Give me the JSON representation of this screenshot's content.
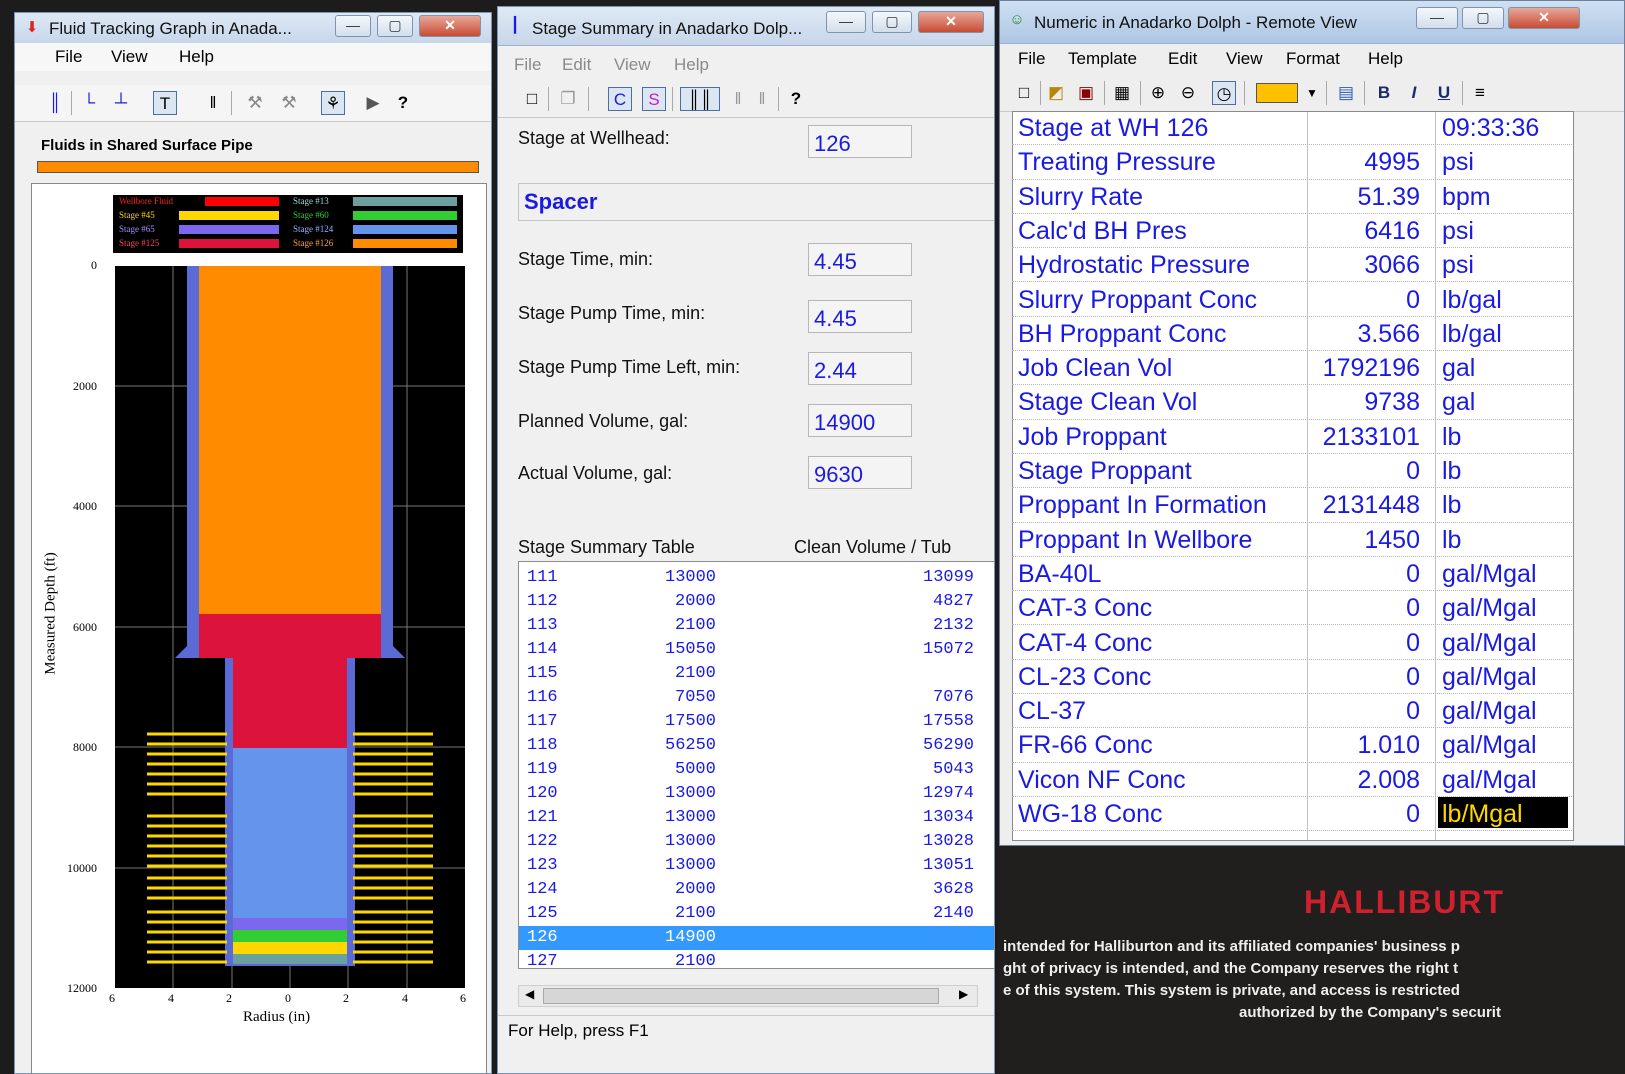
{
  "w1": {
    "title": "Fluid Tracking Graph in Anada...",
    "menu": [
      "File",
      "View",
      "Help"
    ],
    "pipe_label": "Fluids in Shared Surface Pipe",
    "legend": [
      {
        "name": "Wellbore Fluid",
        "color": "#ff0000"
      },
      {
        "name": "Stage #13",
        "color": "#6aa0a0"
      },
      {
        "name": "Stage #45",
        "color": "#ffd700"
      },
      {
        "name": "Stage #60",
        "color": "#32cd32"
      },
      {
        "name": "Stage #65",
        "color": "#7b68ee"
      },
      {
        "name": "Stage #124",
        "color": "#6495ed"
      },
      {
        "name": "Stage #125",
        "color": "#dc143c"
      },
      {
        "name": "Stage #126",
        "color": "#ff8c00"
      }
    ],
    "ylabel": "Measured Depth (ft)",
    "xlabel": "Radius (in)",
    "yticks": [
      "0",
      "2000",
      "4000",
      "6000",
      "8000",
      "10000",
      "12000"
    ],
    "xticks": [
      "6",
      "4",
      "2",
      "0",
      "2",
      "4",
      "6"
    ]
  },
  "w2": {
    "title": "Stage Summary in Anadarko Dolp...",
    "menu": [
      "File",
      "Edit",
      "View",
      "Help"
    ],
    "fields": [
      {
        "label": "Stage at Wellhead:",
        "value": "126"
      },
      {
        "label": "Stage Time, min:",
        "value": "4.45"
      },
      {
        "label": "Stage Pump Time, min:",
        "value": "4.45"
      },
      {
        "label": "Stage Pump Time Left, min:",
        "value": "2.44"
      },
      {
        "label": "Planned Volume, gal:",
        "value": "14900"
      },
      {
        "label": "Actual Volume, gal:",
        "value": "9630"
      }
    ],
    "fluid": "Spacer",
    "table_title": "Stage Summary Table",
    "table_col2": "Clean Volume  / Tub",
    "rows": [
      [
        "111",
        "13000",
        "13099"
      ],
      [
        "112",
        "2000",
        "4827"
      ],
      [
        "113",
        "2100",
        "2132"
      ],
      [
        "114",
        "15050",
        "15072"
      ],
      [
        "115",
        "2100",
        ""
      ],
      [
        "116",
        "7050",
        "7076"
      ],
      [
        "117",
        "17500",
        "17558"
      ],
      [
        "118",
        "56250",
        "56290"
      ],
      [
        "119",
        "5000",
        "5043"
      ],
      [
        "120",
        "13000",
        "12974"
      ],
      [
        "121",
        "13000",
        "13034"
      ],
      [
        "122",
        "13000",
        "13028"
      ],
      [
        "123",
        "13000",
        "13051"
      ],
      [
        "124",
        "2000",
        "3628"
      ],
      [
        "125",
        "2100",
        "2140"
      ],
      [
        "126",
        "14900",
        ""
      ],
      [
        "127",
        "2100",
        ""
      ]
    ],
    "status": "For Help, press F1"
  },
  "w3": {
    "title": "Numeric in Anadarko Dolph - Remote View",
    "menu": [
      "File",
      "Template",
      "Edit",
      "View",
      "Format",
      "Help"
    ],
    "rows": [
      {
        "label": "Stage at WH 126",
        "value": "",
        "unit": "09:33:36"
      },
      {
        "label": "Treating Pressure",
        "value": "4995",
        "unit": "psi"
      },
      {
        "label": "Slurry Rate",
        "value": "51.39",
        "unit": "bpm"
      },
      {
        "label": "Calc'd BH Pres",
        "value": "6416",
        "unit": "psi"
      },
      {
        "label": "Hydrostatic Pressure",
        "value": "3066",
        "unit": "psi"
      },
      {
        "label": "Slurry Proppant Conc",
        "value": "0",
        "unit": "lb/gal"
      },
      {
        "label": "BH Proppant Conc",
        "value": "3.566",
        "unit": "lb/gal"
      },
      {
        "label": "Job Clean Vol",
        "value": "1792196",
        "unit": "gal"
      },
      {
        "label": "Stage Clean Vol",
        "value": "9738",
        "unit": "gal"
      },
      {
        "label": "Job Proppant",
        "value": "2133101",
        "unit": "lb"
      },
      {
        "label": "Stage Proppant",
        "value": "0",
        "unit": "lb"
      },
      {
        "label": "Proppant In Formation",
        "value": "2131448",
        "unit": "lb"
      },
      {
        "label": "Proppant In Wellbore",
        "value": "1450",
        "unit": "lb"
      },
      {
        "label": "BA-40L",
        "value": "0",
        "unit": "gal/Mgal"
      },
      {
        "label": "CAT-3 Conc",
        "value": "0",
        "unit": "gal/Mgal"
      },
      {
        "label": "CAT-4 Conc",
        "value": "0",
        "unit": "gal/Mgal"
      },
      {
        "label": "CL-23 Conc",
        "value": "0",
        "unit": "gal/Mgal"
      },
      {
        "label": "CL-37",
        "value": "0",
        "unit": "gal/Mgal"
      },
      {
        "label": "FR-66 Conc",
        "value": "1.010",
        "unit": "gal/Mgal"
      },
      {
        "label": "Vicon NF Conc",
        "value": "2.008",
        "unit": "gal/Mgal"
      },
      {
        "label": "WG-18 Conc",
        "value": "0",
        "unit": "lb/Mgal"
      }
    ]
  },
  "banner": {
    "company": "HALLIBURT",
    "lines": [
      "intended for Halliburton and its affiliated companies' business p",
      "ght of privacy is intended, and the Company reserves the right t",
      "e of this system.  This system is private, and access is restricted",
      "authorized by the Company's securit"
    ]
  }
}
